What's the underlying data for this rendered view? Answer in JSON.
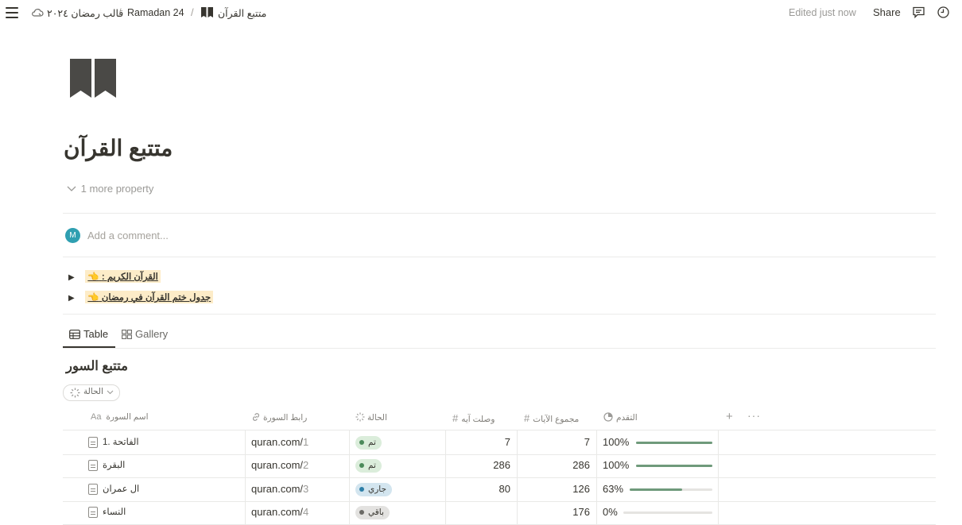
{
  "topbar": {
    "breadcrumb": [
      "قالب رمضان ٢٠٢٤",
      "Ramadan 24",
      "متتبع القرآن"
    ],
    "edited": "Edited just now",
    "share": "Share"
  },
  "page": {
    "title": "متتبع القرآن",
    "more_property": "1 more property",
    "avatar_initial": "M",
    "comment_placeholder": "Add a comment...",
    "toggles": [
      {
        "label": "القرآن الكريم :",
        "emoji": "👈"
      },
      {
        "label": "جدول ختم القرآن في رمضان",
        "emoji": "👈"
      }
    ]
  },
  "views": {
    "tabs": [
      "Table",
      "Gallery"
    ],
    "active": "Table"
  },
  "database": {
    "title": "متتبع السور",
    "filter_label": "الحالة",
    "columns": [
      "اسم السورة",
      "رابط السورة",
      "الحالة",
      "وصلت آيه",
      "مجموع الآيات",
      "التقدم"
    ],
    "rows": [
      {
        "name": "الفاتحة .1",
        "link_host": "quran.com/",
        "link_num": "1",
        "status": "تم",
        "status_color": "#4b8a5a",
        "status_bg": "#dbeddb",
        "reached": "7",
        "total": "7",
        "progress_text": "100%",
        "progress": 1.0
      },
      {
        "name": "البقرة",
        "link_host": "quran.com/",
        "link_num": "2",
        "status": "تم",
        "status_color": "#4b8a5a",
        "status_bg": "#dbeddb",
        "reached": "286",
        "total": "286",
        "progress_text": "100%",
        "progress": 1.0
      },
      {
        "name": "ال عمران",
        "link_host": "quran.com/",
        "link_num": "3",
        "status": "جاري",
        "status_color": "#2e7fa8",
        "status_bg": "#d3e5ef",
        "reached": "80",
        "total": "126",
        "progress_text": "63%",
        "progress": 0.63
      },
      {
        "name": "النساء",
        "link_host": "quran.com/",
        "link_num": "4",
        "status": "باقي",
        "status_color": "#6b6a66",
        "status_bg": "#e3e2e0",
        "reached": "",
        "total": "176",
        "progress_text": "0%",
        "progress": 0.0
      }
    ]
  },
  "colors": {
    "accent": "#6f9a7b",
    "text": "#37352f",
    "muted": "#9b9a97"
  }
}
